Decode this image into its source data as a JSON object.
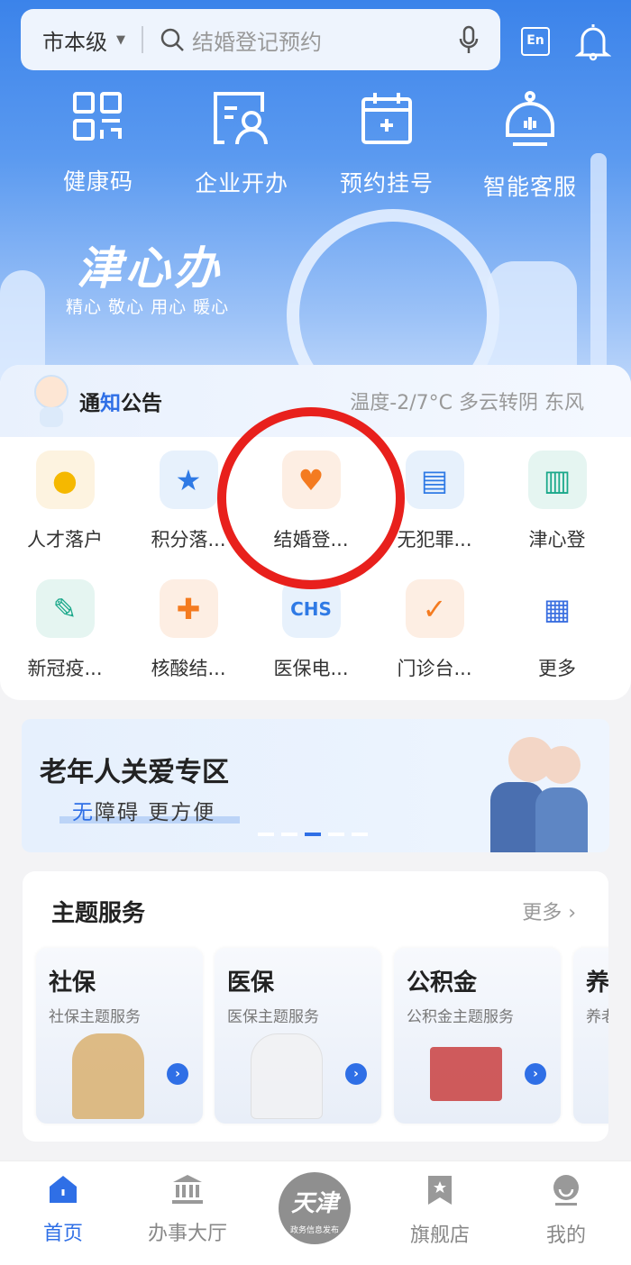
{
  "header": {
    "region": "市本级",
    "search_placeholder": "结婚登记预约",
    "lang_button": "En",
    "quick_actions": [
      {
        "label": "健康码",
        "icon": "qr-code-icon"
      },
      {
        "label": "企业开办",
        "icon": "enterprise-icon"
      },
      {
        "label": "预约挂号",
        "icon": "calendar-add-icon"
      },
      {
        "label": "智能客服",
        "icon": "robot-icon"
      }
    ],
    "brand": "津心办",
    "slogan": "精心 敬心 用心 暖心"
  },
  "notice": {
    "title_a": "通",
    "title_b": "知",
    "title_c": "公告",
    "weather": "温度-2/7°C 多云转阴 东风"
  },
  "services": [
    {
      "label": "人才落户",
      "icon": "talent-icon",
      "bg": "#fdf3e0",
      "color": "#f5b800"
    },
    {
      "label": "积分落...",
      "icon": "star-icon",
      "bg": "#e7f1fc",
      "color": "#2f7ae5"
    },
    {
      "label": "结婚登...",
      "icon": "couple-icon",
      "bg": "#fdeee3",
      "color": "#f47b20"
    },
    {
      "label": "无犯罪...",
      "icon": "document-icon",
      "bg": "#e7f1fc",
      "color": "#2f7ae5"
    },
    {
      "label": "津心登",
      "icon": "building-icon",
      "bg": "#e5f5f1",
      "color": "#1aa88a"
    },
    {
      "label": "新冠疫...",
      "icon": "syringe-icon",
      "bg": "#e5f5f1",
      "color": "#1aa88a"
    },
    {
      "label": "核酸结...",
      "icon": "shield-plus-icon",
      "bg": "#fdeee3",
      "color": "#f47b20"
    },
    {
      "label": "医保电...",
      "icon": "chs-logo-icon",
      "bg": "#e7f1fc",
      "color": "#2f7ae5"
    },
    {
      "label": "门诊台...",
      "icon": "clipboard-check-icon",
      "bg": "#fdeee3",
      "color": "#f47b20"
    },
    {
      "label": "更多",
      "icon": "grid-icon",
      "bg": "#ffffff",
      "color": "#3b6fe0"
    }
  ],
  "elder": {
    "title": "老年人关爱专区",
    "sub_a": "无",
    "sub_b": "障碍 更方便",
    "active_dot": 3,
    "dot_count": 5
  },
  "theme": {
    "title": "主题服务",
    "more": "更多",
    "cards": [
      {
        "title": "社保",
        "sub": "社保主题服务"
      },
      {
        "title": "医保",
        "sub": "医保主题服务"
      },
      {
        "title": "公积金",
        "sub": "公积金主题服务"
      },
      {
        "title": "养",
        "sub": "养老"
      }
    ]
  },
  "nav": {
    "items": [
      {
        "label": "首页",
        "active": true
      },
      {
        "label": "办事大厅"
      },
      {
        "label": "旗舰店"
      },
      {
        "label": "我的"
      }
    ],
    "center_logo": "天津",
    "center_sub": "政务信息发布"
  },
  "colors": {
    "accent": "#2f6fe6",
    "annotation": "#e8201c"
  }
}
